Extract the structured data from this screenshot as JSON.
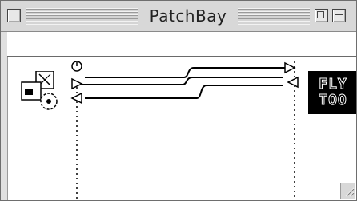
{
  "window": {
    "title": "PatchBay"
  },
  "device_logo": {
    "line1": "FLY",
    "line2": "TOO"
  },
  "icons": {
    "close": "close-box",
    "zoom": "zoom-box",
    "collapse": "windowshade-box",
    "app": "midi-app-icon",
    "clock": "clock-icon",
    "grow": "grow-box"
  },
  "colors": {
    "titlebar": "#d8d8d8",
    "line": "#000000",
    "logo_bg": "#000000"
  }
}
